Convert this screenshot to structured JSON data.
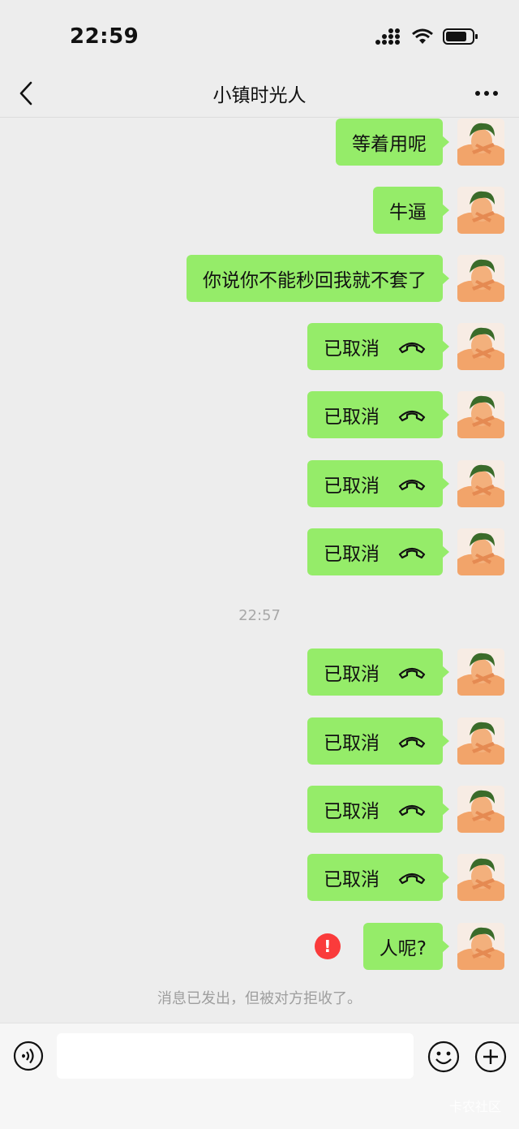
{
  "status_bar": {
    "time": "22:59"
  },
  "header": {
    "title": "小镇时光人"
  },
  "messages": [
    {
      "text": "等着用呢",
      "call": false
    },
    {
      "text": "牛逼",
      "call": false
    },
    {
      "text": "你说你不能秒回我就不套了",
      "call": false
    },
    {
      "text": "已取消",
      "call": true
    },
    {
      "text": "已取消",
      "call": true
    },
    {
      "text": "已取消",
      "call": true
    },
    {
      "text": "已取消",
      "call": true
    },
    {
      "text": "已取消",
      "call": true
    },
    {
      "text": "已取消",
      "call": true
    },
    {
      "text": "已取消",
      "call": true
    },
    {
      "text": "已取消",
      "call": true
    },
    {
      "text": "人呢?",
      "call": false,
      "failed": true
    }
  ],
  "timestamp": "22:57",
  "failed_icon_text": "!",
  "system_notice": "消息已发出，但被对方拒收了。",
  "watermark": "卡农社区",
  "icons": {
    "back": "chevron-left-icon",
    "more": "more-dots-icon",
    "call": "phone-hangup-icon",
    "voice": "voice-icon",
    "emoji": "emoji-icon",
    "plus": "plus-icon"
  },
  "colors": {
    "bubble": "#95ec69",
    "background": "#ededed",
    "error": "#fa3b3b"
  }
}
